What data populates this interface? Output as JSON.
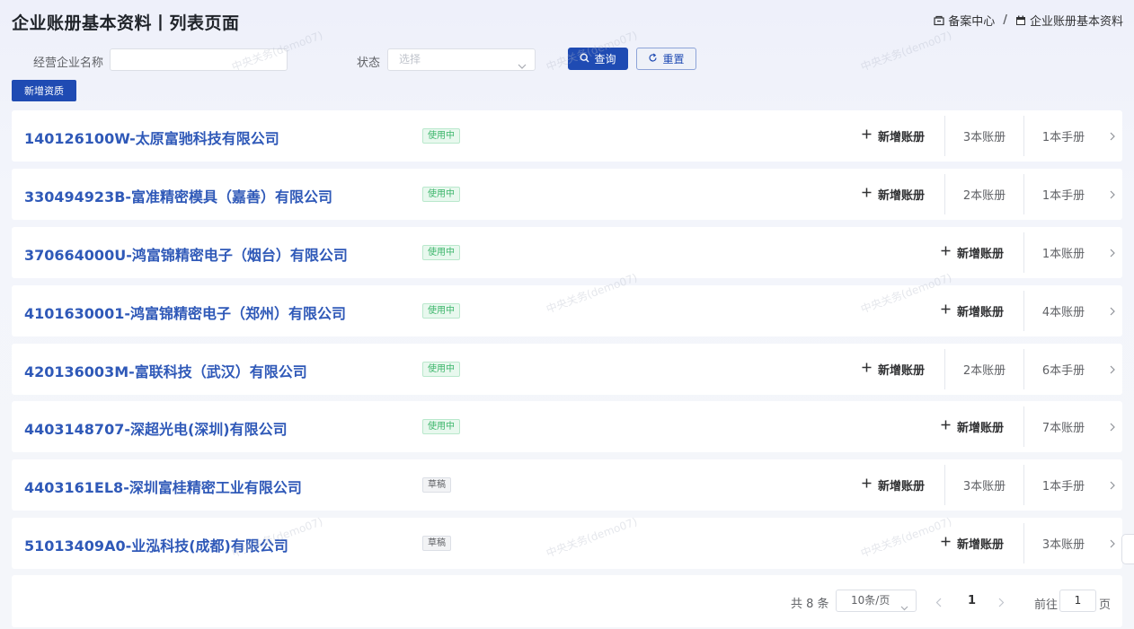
{
  "header": {
    "title": "企业账册基本资料丨列表页面",
    "breadcrumb": [
      {
        "label": "备案中心",
        "icon": "folder-icon"
      },
      {
        "label": "企业账册基本资料",
        "icon": "calendar-icon"
      }
    ],
    "separator": "/"
  },
  "filter": {
    "company_label": "经营企业名称",
    "company_value": "",
    "status_label": "状态",
    "status_placeholder": "选择",
    "search_label": "查询",
    "reset_label": "重置"
  },
  "add_button_label": "新增资质",
  "rows": [
    {
      "title": "140126100W-太原富驰科技有限公司",
      "status": "使用中",
      "add_label": "新增账册",
      "books": "3本账册",
      "manuals": "1本手册"
    },
    {
      "title": "330494923B-富准精密模具（嘉善）有限公司",
      "status": "使用中",
      "add_label": "新增账册",
      "books": "2本账册",
      "manuals": "1本手册"
    },
    {
      "title": "370664000U-鸿富锦精密电子（烟台）有限公司",
      "status": "使用中",
      "add_label": "新增账册",
      "books": "",
      "manuals": "1本账册"
    },
    {
      "title": "4101630001-鸿富锦精密电子（郑州）有限公司",
      "status": "使用中",
      "add_label": "新增账册",
      "books": "",
      "manuals": "4本账册"
    },
    {
      "title": "420136003M-富联科技（武汉）有限公司",
      "status": "使用中",
      "add_label": "新增账册",
      "books": "2本账册",
      "manuals": "6本手册"
    },
    {
      "title": "4403148707-深超光电(深圳)有限公司",
      "status": "使用中",
      "add_label": "新增账册",
      "books": "",
      "manuals": "7本账册"
    },
    {
      "title": "4403161EL8-深圳富桂精密工业有限公司",
      "status": "草稿",
      "add_label": "新增账册",
      "books": "3本账册",
      "manuals": "1本手册"
    },
    {
      "title": "51013409A0-业泓科技(成都)有限公司",
      "status": "草稿",
      "add_label": "新增账册",
      "books": "",
      "manuals": "3本账册"
    }
  ],
  "pagination": {
    "total": "共 8 条",
    "page_size": "10条/页",
    "current_page": "1",
    "goto_label": "前往",
    "goto_value": "1",
    "page_suffix": "页"
  },
  "watermark": "中央关务(demo07)",
  "colors": {
    "primary": "#1f4bb3",
    "link": "#2f59b8",
    "active_tag": "#3bb56a"
  }
}
